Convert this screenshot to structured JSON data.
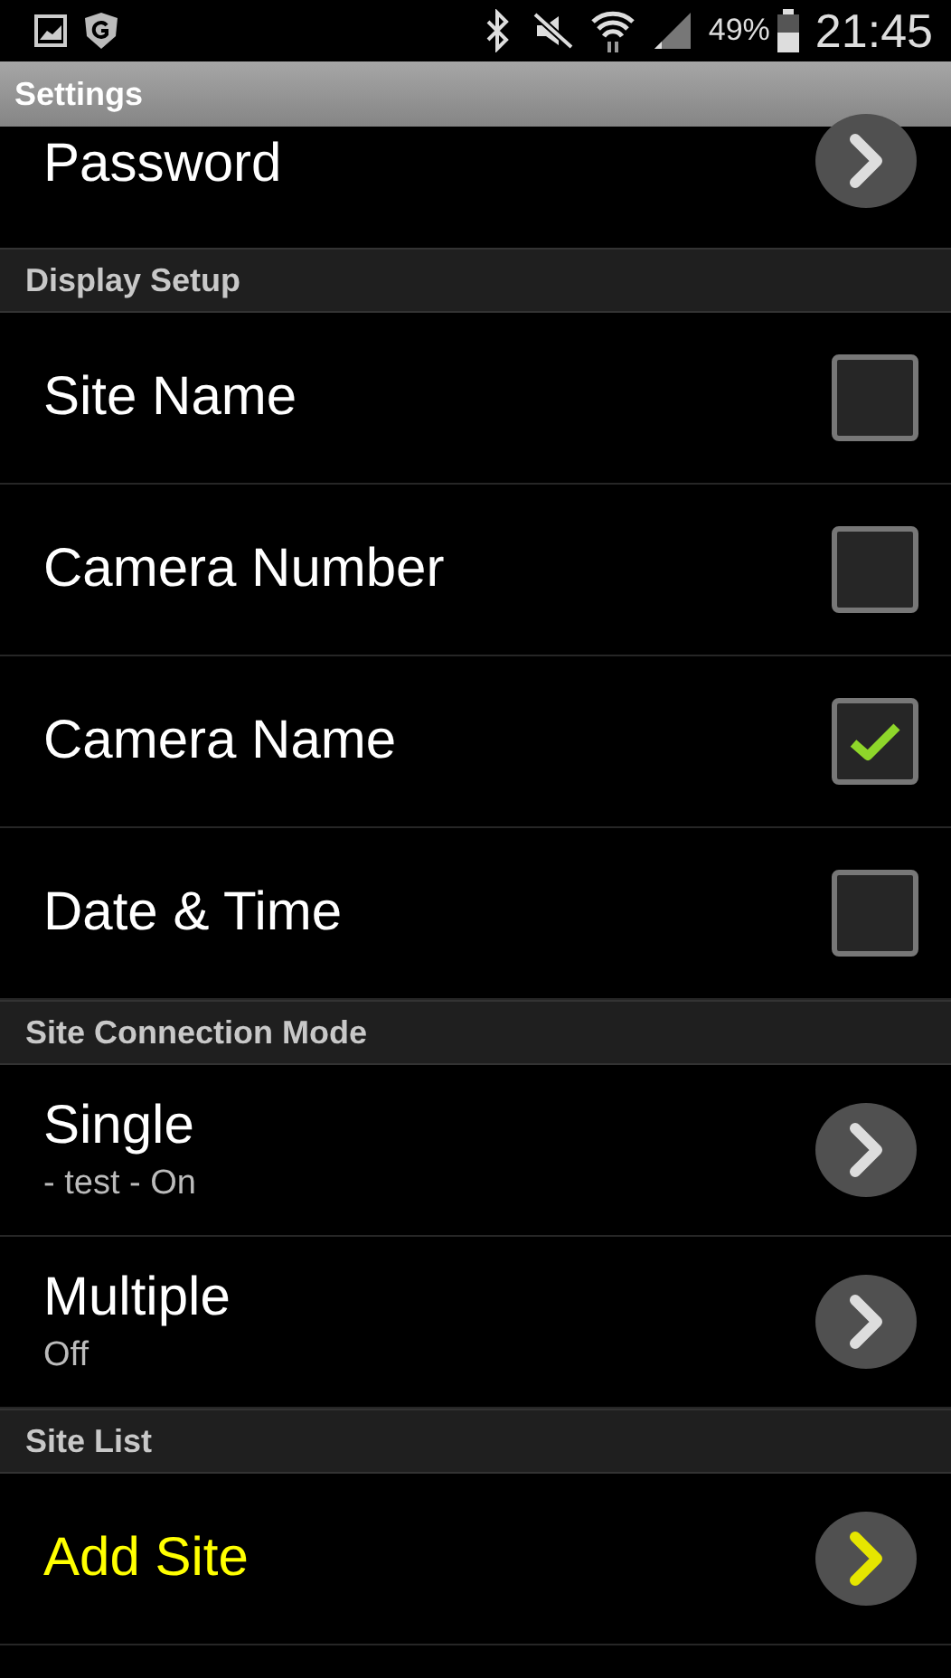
{
  "status_bar": {
    "battery": "49%",
    "time": "21:45"
  },
  "title_bar": {
    "title": "Settings"
  },
  "sections": [
    {
      "items": [
        {
          "kind": "nav",
          "label": "Password",
          "accent": false
        }
      ]
    },
    {
      "header": "Display Setup",
      "items": [
        {
          "kind": "checkbox",
          "label": "Site Name",
          "checked": false
        },
        {
          "kind": "checkbox",
          "label": "Camera Number",
          "checked": false
        },
        {
          "kind": "checkbox",
          "label": "Camera Name",
          "checked": true
        },
        {
          "kind": "checkbox",
          "label": "Date & Time",
          "checked": false
        }
      ]
    },
    {
      "header": "Site Connection Mode",
      "items": [
        {
          "kind": "nav",
          "label": "Single",
          "summary": "- test - On",
          "accent": false
        },
        {
          "kind": "nav",
          "label": "Multiple",
          "summary": "Off",
          "accent": false
        }
      ]
    },
    {
      "header": "Site List",
      "items": [
        {
          "kind": "nav",
          "label": "Add Site",
          "accent": true
        }
      ]
    }
  ]
}
